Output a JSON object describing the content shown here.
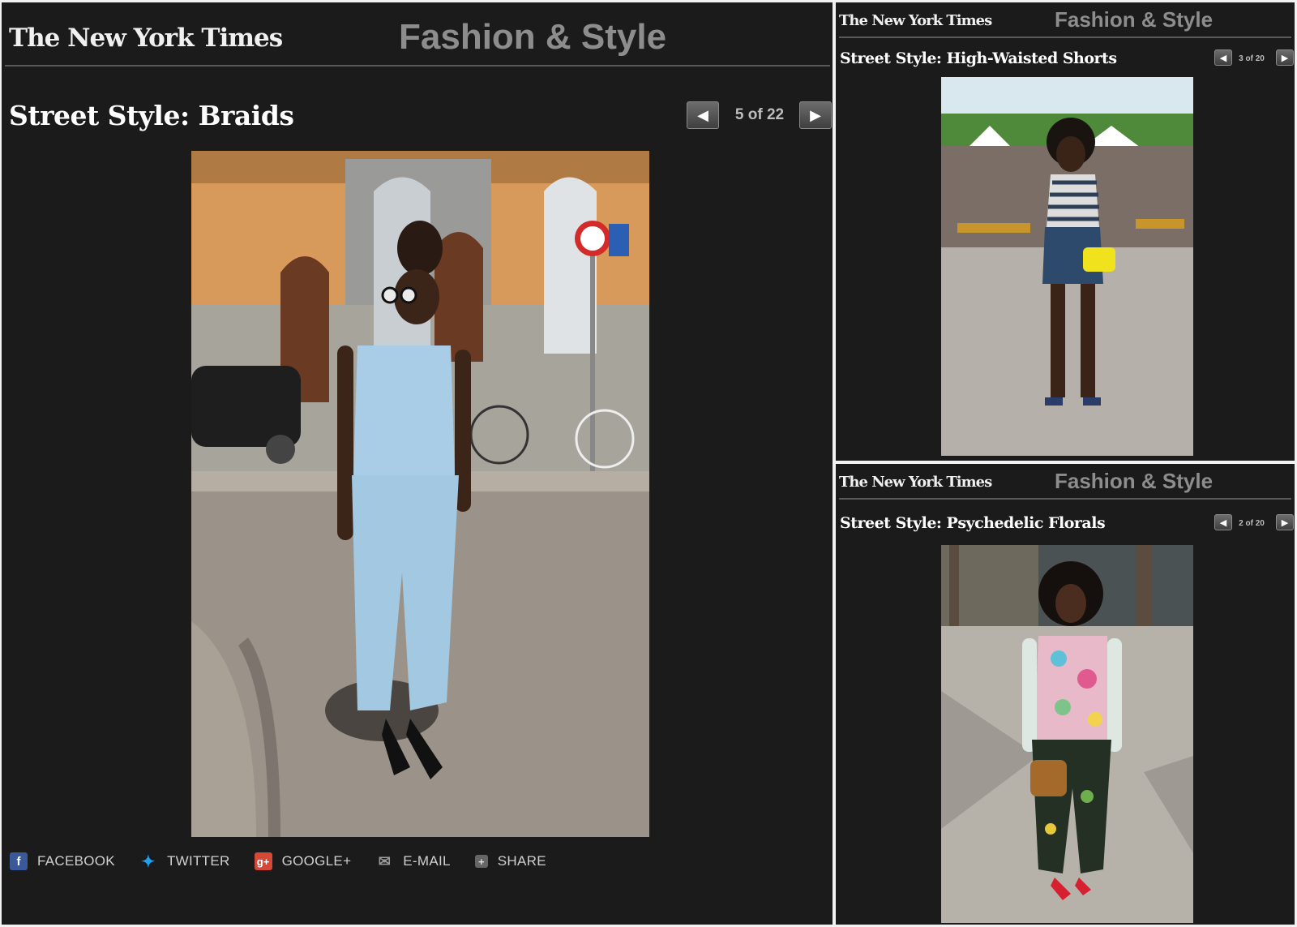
{
  "colors": {
    "panel_bg": "#1b1b1b",
    "section_title": "#8d8d8d",
    "rule": "#5a5a5a",
    "facebook": "#3b5998",
    "twitter": "#1da1f2",
    "google_plus": "#d34836"
  },
  "main": {
    "logo": "The New York Times",
    "section": "Fashion & Style",
    "title": "Street Style: Braids",
    "counter": "5 of 22",
    "prev_icon": "left-arrow-icon",
    "next_icon": "right-arrow-icon",
    "share": [
      {
        "label": "FACEBOOK",
        "icon": "facebook-icon"
      },
      {
        "label": "TWITTER",
        "icon": "twitter-icon"
      },
      {
        "label": "GOOGLE+",
        "icon": "google-plus-icon"
      },
      {
        "label": "E-MAIL",
        "icon": "email-icon"
      },
      {
        "label": "SHARE",
        "icon": "share-icon"
      }
    ]
  },
  "right_top": {
    "logo": "The New York Times",
    "section": "Fashion & Style",
    "title": "Street Style: High-Waisted Shorts",
    "counter": "3 of 20"
  },
  "right_bottom": {
    "logo": "The New York Times",
    "section": "Fashion & Style",
    "title": "Street Style: Psychedelic Florals",
    "counter": "2 of 20"
  }
}
